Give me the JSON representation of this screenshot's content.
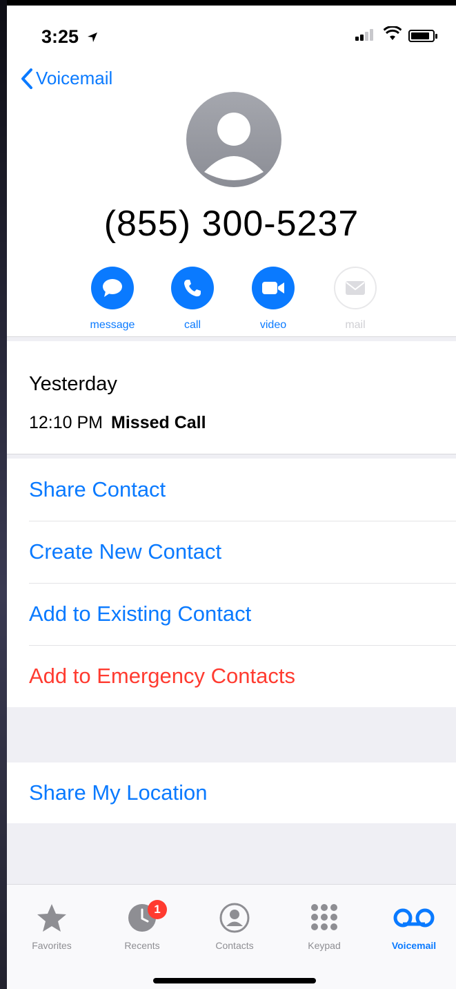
{
  "status_bar": {
    "time": "3:25"
  },
  "nav": {
    "back_label": "Voicemail"
  },
  "contact": {
    "phone_number": "(855) 300-5237"
  },
  "actions": [
    {
      "label": "message",
      "icon": "message-bubble-icon",
      "enabled": true
    },
    {
      "label": "call",
      "icon": "phone-icon",
      "enabled": true
    },
    {
      "label": "video",
      "icon": "video-camera-icon",
      "enabled": true
    },
    {
      "label": "mail",
      "icon": "envelope-icon",
      "enabled": false
    }
  ],
  "call_info": {
    "day": "Yesterday",
    "time": "12:10 PM",
    "type": "Missed Call"
  },
  "options": [
    {
      "label": "Share Contact",
      "color": "#0a7aff"
    },
    {
      "label": "Create New Contact",
      "color": "#0a7aff"
    },
    {
      "label": "Add to Existing Contact",
      "color": "#0a7aff"
    },
    {
      "label": "Add to Emergency Contacts",
      "color": "#ff3b30"
    }
  ],
  "location_option": {
    "label": "Share My Location"
  },
  "tabs": [
    {
      "label": "Favorites",
      "icon": "star-icon",
      "active": false
    },
    {
      "label": "Recents",
      "icon": "clock-icon",
      "active": false,
      "badge": "1"
    },
    {
      "label": "Contacts",
      "icon": "person-circle-icon",
      "active": false
    },
    {
      "label": "Keypad",
      "icon": "keypad-icon",
      "active": false
    },
    {
      "label": "Voicemail",
      "icon": "voicemail-icon",
      "active": true
    }
  ],
  "colors": {
    "accent": "#0a7aff",
    "destructive": "#ff3b30",
    "badge": "#ff3b30"
  }
}
